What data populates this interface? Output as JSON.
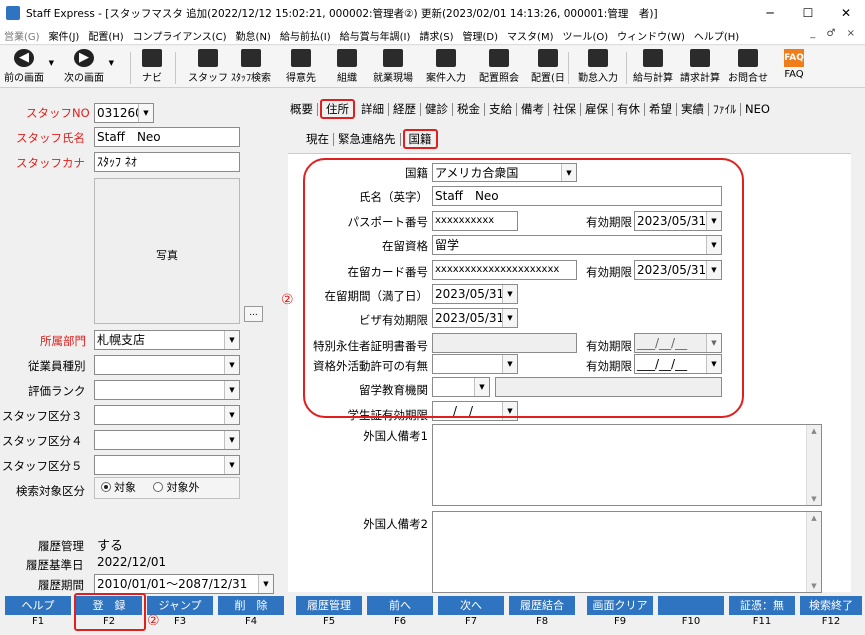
{
  "window": {
    "title": "Staff Express - [スタッフマスタ 追加(2022/12/12 15:02:21, 000002:管理者②) 更新(2023/02/01 14:13:26, 000001:管理　者)]",
    "controls": [
      "─",
      "☐",
      "✕"
    ]
  },
  "menu": {
    "items": [
      "営業(G)",
      "案件(J)",
      "配置(H)",
      "コンプライアンス(C)",
      "勤怠(N)",
      "給与前払(I)",
      "給与賞与年調(I)",
      "請求(S)",
      "管理(D)",
      "マスタ(M)",
      "ツール(O)",
      "ウィンドウ(W)",
      "ヘルプ(H)"
    ],
    "mdi_controls": "_ ♂ ×"
  },
  "toolbar": {
    "buttons": [
      "前の画面",
      "次の画面",
      "ナビ",
      "スタッフ",
      "ｽﾀｯﾌ検索",
      "得意先",
      "組織",
      "就業現場",
      "案件入力",
      "配置照会",
      "配置(日",
      "勤怠入力",
      "給与計算",
      "請求計算",
      "お問合せ",
      "FAQ"
    ],
    "faq_icon_text": "FAQ"
  },
  "left": {
    "staff_no_label": "スタッフNO",
    "staff_no_value": "031260",
    "staff_name_label": "スタッフ氏名",
    "staff_name_value": "Staff　Neo",
    "staff_kana_label": "スタッフカナ",
    "staff_kana_value": "ｽﾀｯﾌ ﾈｵ",
    "photo_label": "写真",
    "photo_button": "...",
    "dept_label": "所属部門",
    "dept_value": "札幌支店",
    "emp_type_label": "従業員種別",
    "rank_label": "評価ランク",
    "staff_cat3_label": "スタッフ区分３",
    "staff_cat4_label": "スタッフ区分４",
    "staff_cat5_label": "スタッフ区分５",
    "search_target_label": "検索対象区分",
    "radio_on": "対象",
    "radio_off": "対象外",
    "history_mgmt_label": "履歴管理",
    "history_mgmt_value": "する",
    "history_base_label": "履歴基準日",
    "history_base_value": "2022/12/01",
    "history_period_label": "履歴期間",
    "history_period_value": "2010/01/01～2087/12/31"
  },
  "tabs": [
    "概要",
    "住所",
    "詳細",
    "経歴",
    "健診",
    "税金",
    "支給",
    "備考",
    "社保",
    "雇保",
    "有休",
    "希望",
    "実績",
    "ﾌｧｲﾙ",
    "NEO"
  ],
  "subtabs": [
    "現在",
    "緊急連絡先",
    "国籍"
  ],
  "form": {
    "nationality_label": "国籍",
    "nationality_value": "アメリカ合衆国",
    "name_en_label": "氏名（英字）",
    "name_en_value": "Staff　Neo",
    "passport_label": "パスポート番号",
    "passport_value": "xxxxxxxxxx",
    "expiry_label": "有効期限",
    "passport_expiry": "2023/05/31",
    "residence_status_label": "在留資格",
    "residence_status_value": "留学",
    "residence_card_label": "在留カード番号",
    "residence_card_value": "xxxxxxxxxxxxxxxxxxxxx",
    "residence_card_expiry": "2023/05/31",
    "residence_period_label": "在留期間（満了日）",
    "residence_period_value": "2023/05/31",
    "visa_label": "ビザ有効期限",
    "visa_value": "2023/05/31",
    "permanent_label": "特別永住者証明書番号",
    "empty_date": "___/__/__",
    "outside_activity_label": "資格外活動許可の有無",
    "school_label": "留学教育機関",
    "student_card_label": "学生証有効期限",
    "remark1_label": "外国人備考1",
    "remark2_label": "外国人備考2"
  },
  "annotations": {
    "circle_mark": "②"
  },
  "fkeys": [
    {
      "label": "ヘルプ",
      "key": "F1"
    },
    {
      "label": "登　録",
      "key": "F2"
    },
    {
      "label": "ジャンプ",
      "key": "F3"
    },
    {
      "label": "削　除",
      "key": "F4"
    },
    {
      "label": "履歴管理",
      "key": "F5"
    },
    {
      "label": "前へ",
      "key": "F6"
    },
    {
      "label": "次へ",
      "key": "F7"
    },
    {
      "label": "履歴結合",
      "key": "F8"
    },
    {
      "label": "画面クリア",
      "key": "F9"
    },
    {
      "label": "",
      "key": "F10"
    },
    {
      "label": "証憑：無",
      "key": "F11"
    },
    {
      "label": "検索終了",
      "key": "F12"
    }
  ],
  "colors": {
    "accent_red": "#e0201e",
    "fkey_blue": "#2f74c0"
  }
}
